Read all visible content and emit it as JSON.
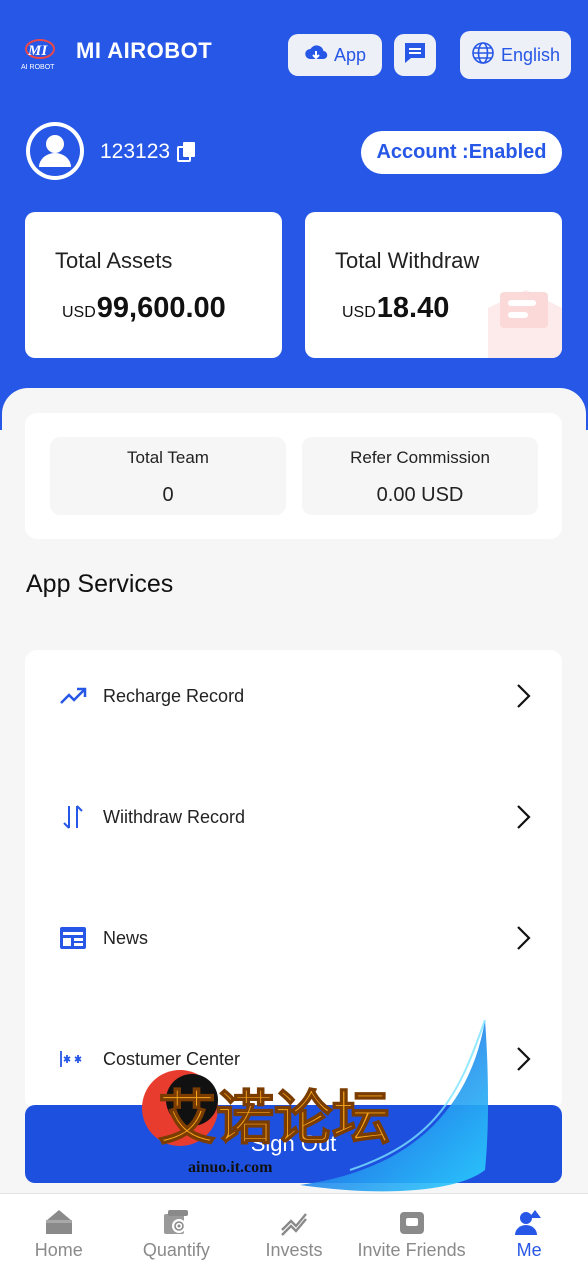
{
  "header": {
    "brand": "MI AIROBOT",
    "logo_text": "AI ROBOT",
    "app_button": "App",
    "language_button": "English"
  },
  "account": {
    "user_id": "123123",
    "status": "Account :Enabled"
  },
  "stats": {
    "total_assets_label": "Total Assets",
    "total_assets_unit": "USD",
    "total_assets_value": "99,600.00",
    "total_withdraw_label": "Total Withdraw",
    "total_withdraw_unit": "USD",
    "total_withdraw_value": "18.40"
  },
  "team": {
    "total_team_label": "Total Team",
    "total_team_value": "0",
    "refer_commission_label": "Refer Commission",
    "refer_commission_value": "0.00 USD"
  },
  "services": {
    "title": "App Services",
    "items": [
      {
        "label": "Recharge Record",
        "icon": "trending-up-icon"
      },
      {
        "label": "Wiithdraw Record",
        "icon": "transfer-arrows-icon"
      },
      {
        "label": "News",
        "icon": "newspaper-icon"
      },
      {
        "label": "Costumer Center",
        "icon": "customer-service-icon"
      }
    ]
  },
  "sign_out_label": "Sign Out",
  "watermark": {
    "text": "艾诺论坛",
    "subtext": "ainuo.it.com"
  },
  "tabbar": {
    "items": [
      {
        "label": "Home",
        "icon": "home-icon",
        "active": false
      },
      {
        "label": "Quantify",
        "icon": "quantify-icon",
        "active": false
      },
      {
        "label": "Invests",
        "icon": "chart-line-icon",
        "active": false
      },
      {
        "label": "Invite Friends",
        "icon": "gift-box-icon",
        "active": false
      },
      {
        "label": "Me",
        "icon": "user-icon",
        "active": true
      }
    ]
  },
  "colors": {
    "primary": "#2657e6",
    "button": "#1e50e0",
    "background": "#f6f6f6"
  }
}
